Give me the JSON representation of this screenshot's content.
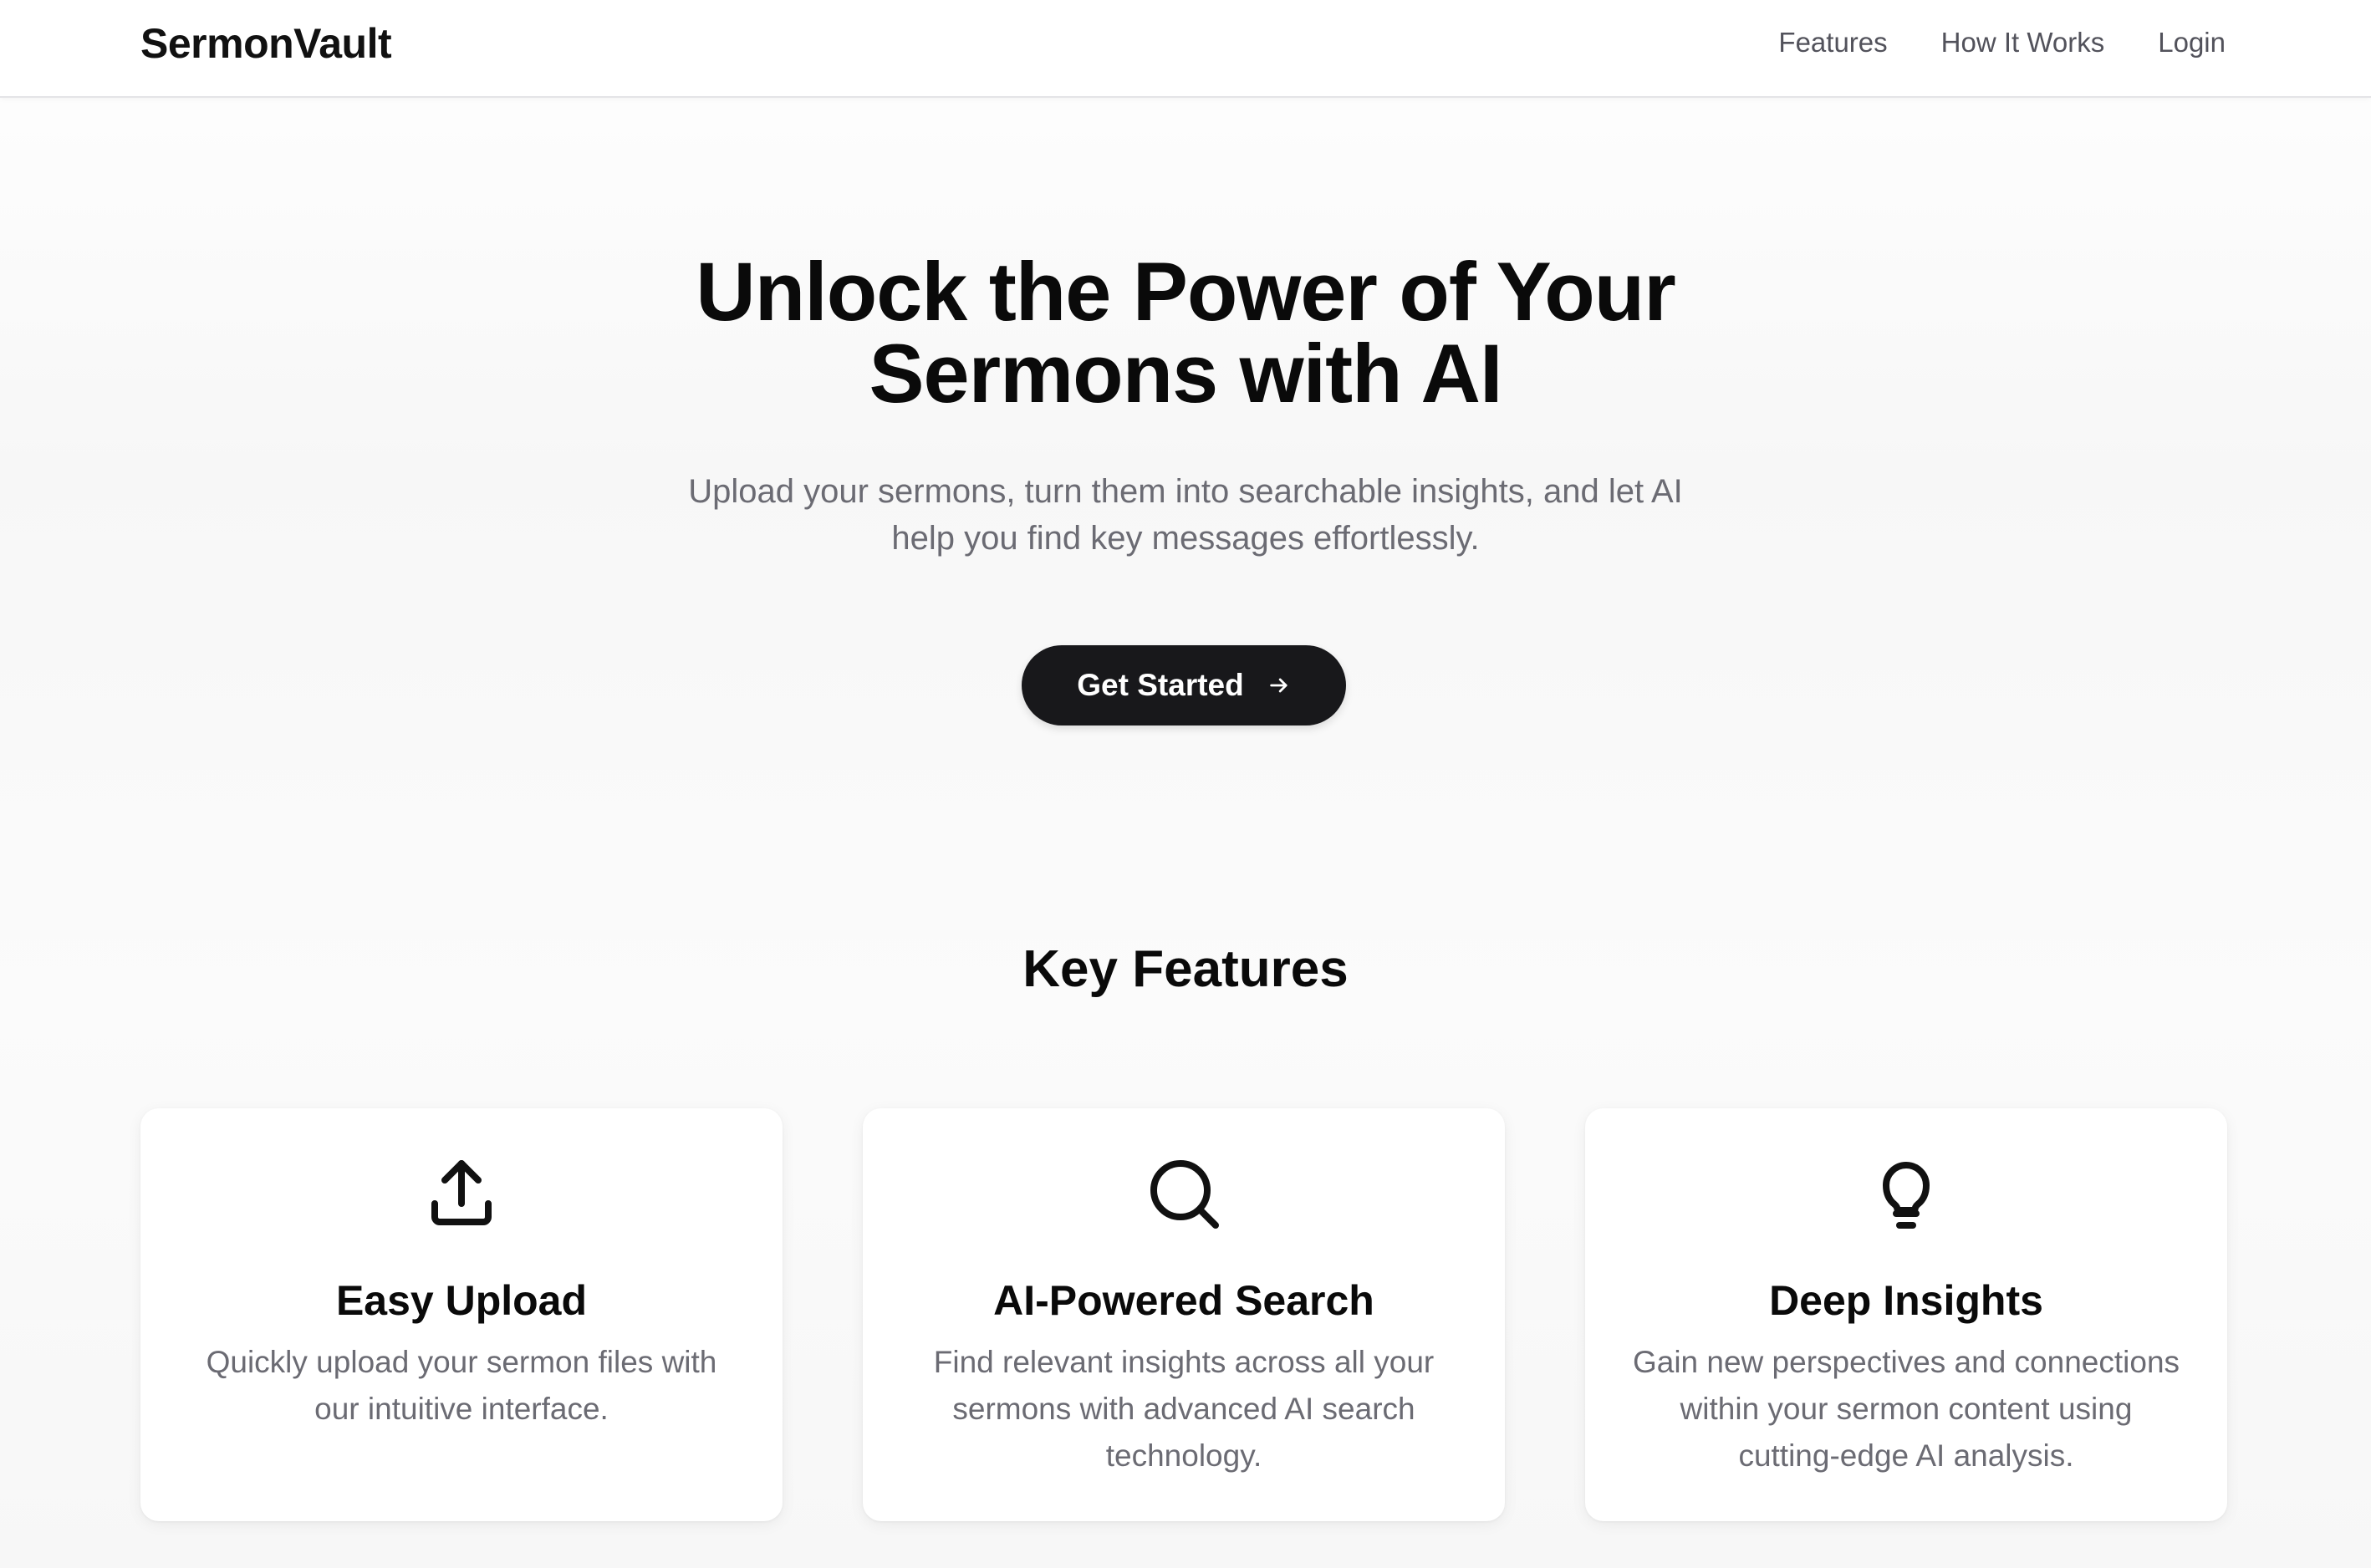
{
  "header": {
    "brand": "SermonVault",
    "nav": [
      "Features",
      "How It Works",
      "Login"
    ]
  },
  "hero": {
    "title_line1": "Unlock the Power of Your",
    "title_line2": "Sermons with AI",
    "subtitle_line1": "Upload your sermons, turn them into searchable insights, and let AI",
    "subtitle_line2": "help you find key messages effortlessly.",
    "cta_label": "Get Started",
    "cta_icon": "arrow-right-icon"
  },
  "features": {
    "heading": "Key Features",
    "cards": [
      {
        "icon": "upload-icon",
        "title": "Easy Upload",
        "text": "Quickly upload your sermon files with our intuitive interface."
      },
      {
        "icon": "search-icon",
        "title": "AI-Powered Search",
        "text": "Find relevant insights across all your sermons with advanced AI search technology."
      },
      {
        "icon": "lightbulb-icon",
        "title": "Deep Insights",
        "text": "Gain new perspectives and connections within your sermon content using cutting-edge AI analysis."
      }
    ]
  },
  "colors": {
    "primary": "#18181b",
    "text": "#0a0a0a",
    "muted": "#6b6b73",
    "nav": "#52525b"
  }
}
